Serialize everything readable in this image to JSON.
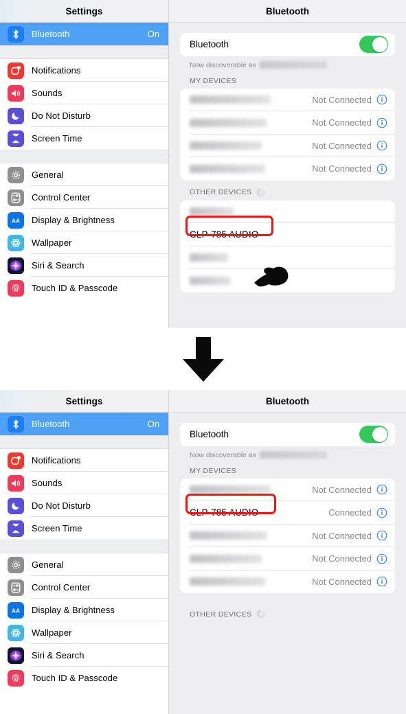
{
  "sidebar": {
    "title": "Settings",
    "groups": [
      {
        "items": [
          {
            "label": "Bluetooth",
            "value": "On",
            "icon": "bluetooth-icon",
            "selected": true
          }
        ]
      },
      {
        "items": [
          {
            "label": "Notifications",
            "value": "",
            "icon": "notifications-icon",
            "selected": false
          },
          {
            "label": "Sounds",
            "value": "",
            "icon": "sounds-icon",
            "selected": false
          },
          {
            "label": "Do Not Disturb",
            "value": "",
            "icon": "do-not-disturb-icon",
            "selected": false
          },
          {
            "label": "Screen Time",
            "value": "",
            "icon": "screen-time-icon",
            "selected": false
          }
        ]
      },
      {
        "items": [
          {
            "label": "General",
            "value": "",
            "icon": "general-gear-icon",
            "selected": false
          },
          {
            "label": "Control Center",
            "value": "",
            "icon": "control-center-icon",
            "selected": false
          },
          {
            "label": "Display & Brightness",
            "value": "",
            "icon": "display-brightness-icon",
            "selected": false
          },
          {
            "label": "Wallpaper",
            "value": "",
            "icon": "wallpaper-icon",
            "selected": false
          },
          {
            "label": "Siri & Search",
            "value": "",
            "icon": "siri-search-icon",
            "selected": false
          },
          {
            "label": "Touch ID & Passcode",
            "value": "",
            "icon": "touch-id-passcode-icon",
            "selected": false
          }
        ]
      }
    ]
  },
  "detail": {
    "title": "Bluetooth",
    "bluetooth_label": "Bluetooth",
    "toggle_state": "on",
    "discoverable_note": "Now discoverable as",
    "discoverable_value_redacted": true,
    "my_devices_header": "MY DEVICES",
    "other_devices_header": "OTHER DEVICES",
    "status_not_connected": "Not Connected",
    "status_connected": "Connected"
  },
  "step1": {
    "my_devices": [
      {
        "name": "",
        "redacted": true,
        "redact_width": 118,
        "status": "Not Connected"
      },
      {
        "name": "",
        "redacted": true,
        "redact_width": 112,
        "status": "Not Connected"
      },
      {
        "name": "",
        "redacted": true,
        "redact_width": 105,
        "status": "Not Connected"
      },
      {
        "name": "",
        "redacted": true,
        "redact_width": 110,
        "status": "Not Connected"
      }
    ],
    "other_devices": [
      {
        "name": "",
        "redacted": true,
        "redact_width": 64,
        "status": "",
        "highlighted": false
      },
      {
        "name": "CLP-785 AUDIO",
        "redacted": false,
        "redact_width": 0,
        "status": "",
        "highlighted": true
      },
      {
        "name": "",
        "redacted": true,
        "redact_width": 56,
        "status": "",
        "highlighted": false
      },
      {
        "name": "",
        "redacted": true,
        "redact_width": 60,
        "status": "",
        "highlighted": false
      }
    ]
  },
  "step2": {
    "my_devices": [
      {
        "name": "",
        "redacted": true,
        "redact_width": 118,
        "status": "Not Connected",
        "highlighted": false
      },
      {
        "name": "CLP-785 AUDIO",
        "redacted": false,
        "redact_width": 0,
        "status": "Connected",
        "highlighted": true
      },
      {
        "name": "",
        "redacted": true,
        "redact_width": 112,
        "status": "Not Connected",
        "highlighted": false
      },
      {
        "name": "",
        "redacted": true,
        "redact_width": 105,
        "status": "Not Connected",
        "highlighted": false
      },
      {
        "name": "",
        "redacted": true,
        "redact_width": 110,
        "status": "Not Connected",
        "highlighted": false
      }
    ],
    "other_devices": []
  },
  "annotations": {
    "arrow": "down-arrow",
    "cursor": "pointing-hand-cursor"
  },
  "colors": {
    "accent_blue": "#4ea1f5",
    "toggle_green": "#34c759",
    "highlight_red": "#f01414",
    "pane_bg": "#eeeef0",
    "secondary_text": "#8a8a8e"
  }
}
